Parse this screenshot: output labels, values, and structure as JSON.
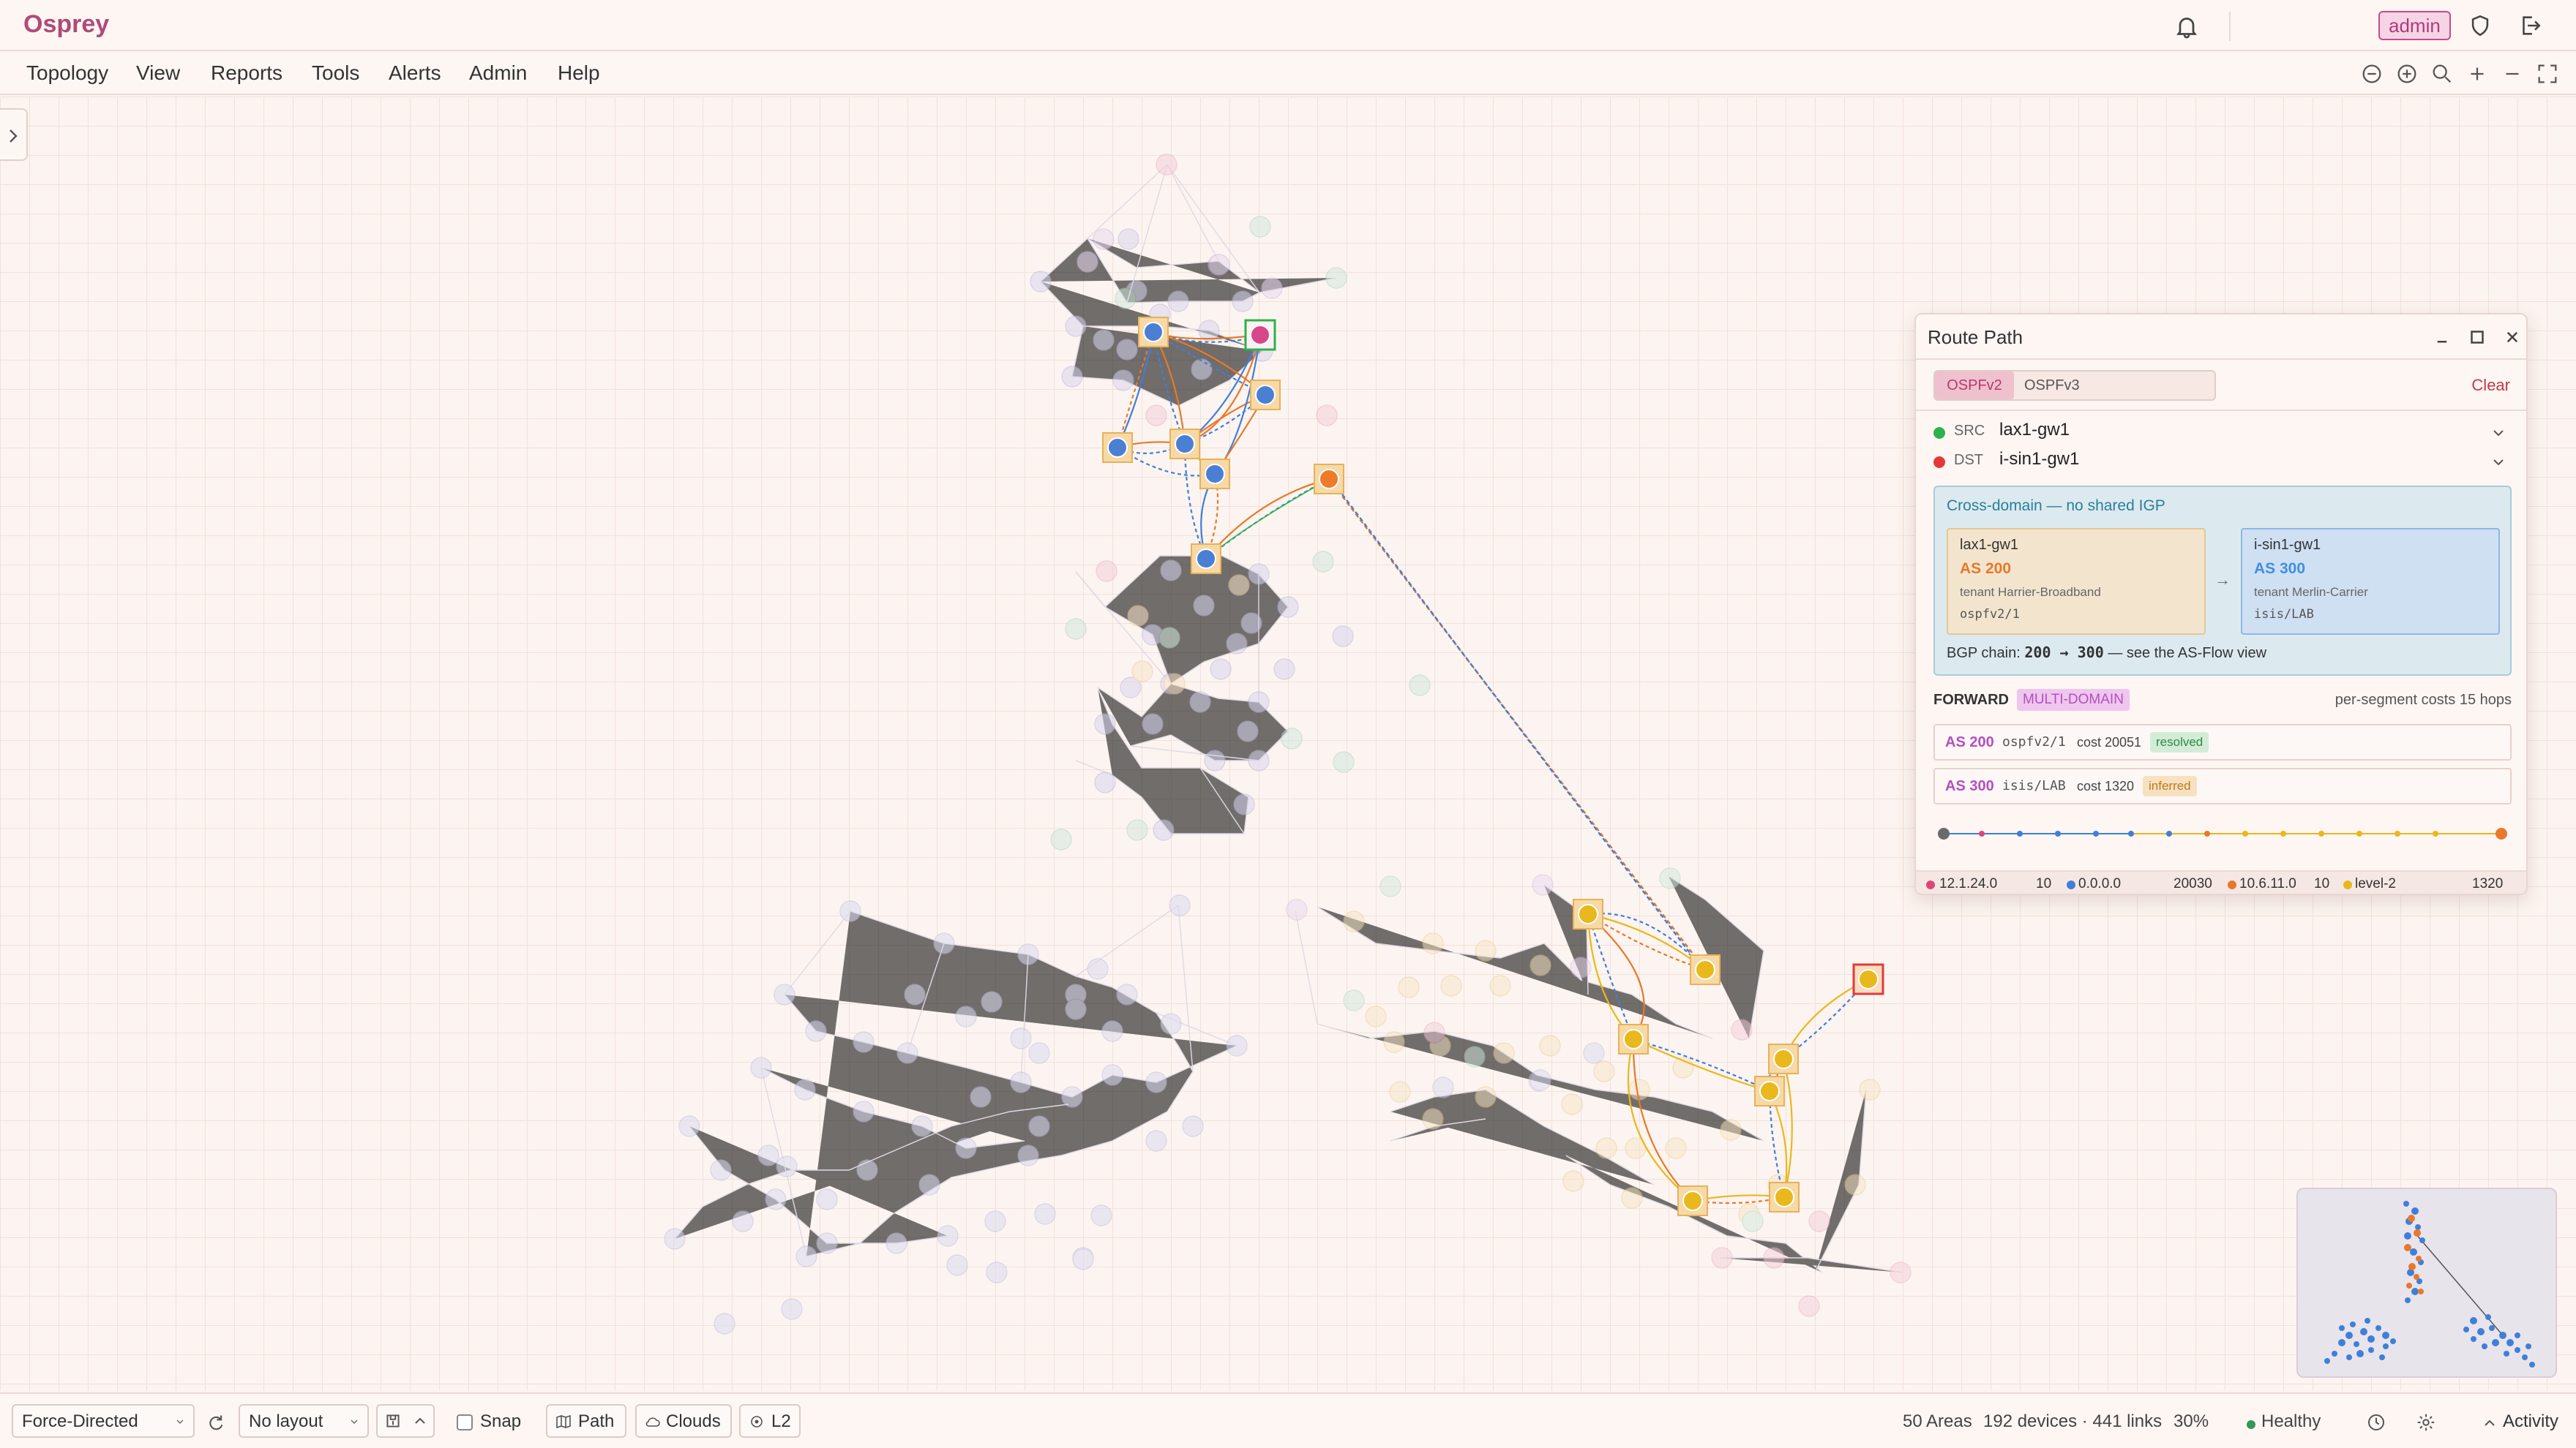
{
  "app": {
    "title": "Osprey",
    "user": "admin"
  },
  "menu": [
    "Topology",
    "View",
    "Reports",
    "Tools",
    "Alerts",
    "Admin",
    "Help"
  ],
  "panel": {
    "title": "Route Path",
    "tabs": [
      "OSPFv2",
      "OSPFv3"
    ],
    "clear_label": "Clear",
    "src_key": "SRC",
    "src_value": "lax1-gw1",
    "dst_key": "DST",
    "dst_value": "i-sin1-gw1",
    "cross_domain": "Cross-domain — no shared IGP",
    "src_card": {
      "name": "lax1-gw1",
      "as": "AS 200",
      "tenant": "tenant Harrier-Broadband",
      "proto": "ospfv2/1"
    },
    "dst_card": {
      "name": "i-sin1-gw1",
      "as": "AS 300",
      "tenant": "tenant Merlin-Carrier",
      "proto": "isis/LAB"
    },
    "arrow": "→",
    "bgp_prefix": "BGP chain:",
    "bgp_chain": "200 → 300",
    "bgp_suffix": "— see the AS-Flow view",
    "forward_label": "FORWARD",
    "forward_badge": "MULTI-DOMAIN",
    "forward_right": "per-segment costs   15 hops",
    "segments": [
      {
        "as": "AS 200",
        "proto": "ospfv2/1",
        "cost": "cost 20051",
        "status": "resolved"
      },
      {
        "as": "AS 300",
        "proto": "isis/LAB",
        "cost": "cost 1320",
        "status": "inferred"
      }
    ],
    "footer": [
      {
        "label": "12.1.24.0",
        "cost": "10",
        "color": "#e0457a"
      },
      {
        "label": "0.0.0.0",
        "cost": "20030",
        "color": "#3f7fd8"
      },
      {
        "label": "10.6.11.0",
        "cost": "10",
        "color": "#e8782a"
      },
      {
        "label": "level-2",
        "cost": "1320",
        "color": "#e8b81c"
      }
    ]
  },
  "bottom": {
    "layout_algo": "Force-Directed",
    "layout_preset": "No layout",
    "snap_label": "Snap",
    "path_label": "Path",
    "clouds_label": "Clouds",
    "l2_label": "L2",
    "areas": "50 Areas",
    "devices": "192 devices · 441 links",
    "zoom": "30%",
    "health": "Healthy",
    "activity": "Activity"
  },
  "colors": {
    "brand": "#b04a78",
    "healthy": "#2f9a55",
    "src": "#2bb24c",
    "dst": "#e23a3a"
  }
}
